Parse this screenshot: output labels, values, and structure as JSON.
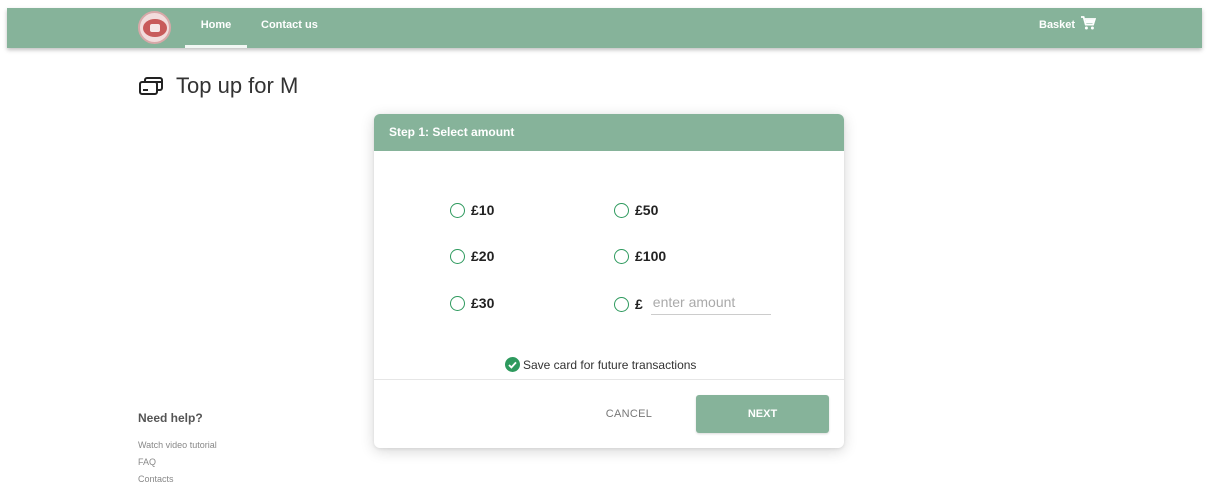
{
  "nav": {
    "items": [
      {
        "label": "Home"
      },
      {
        "label": "Contact us"
      }
    ],
    "basket_label": "Basket"
  },
  "page": {
    "title": "Top up for M"
  },
  "dialog": {
    "header": "Step 1: Select amount",
    "currency": "£",
    "options": [
      {
        "label": "£10"
      },
      {
        "label": "£20"
      },
      {
        "label": "£30"
      },
      {
        "label": "£50"
      },
      {
        "label": "£100"
      }
    ],
    "custom_amount": {
      "value": "",
      "placeholder": "enter amount"
    },
    "save_card_label": "Save card for future transactions",
    "cancel_label": "CANCEL",
    "next_label": "NEXT"
  },
  "help": {
    "title": "Need help?",
    "links": [
      {
        "label": "Watch video tutorial"
      },
      {
        "label": "FAQ"
      },
      {
        "label": "Contacts"
      }
    ]
  },
  "colors": {
    "brand_green": "#86b39a",
    "accent_green": "#2e9a5e"
  }
}
